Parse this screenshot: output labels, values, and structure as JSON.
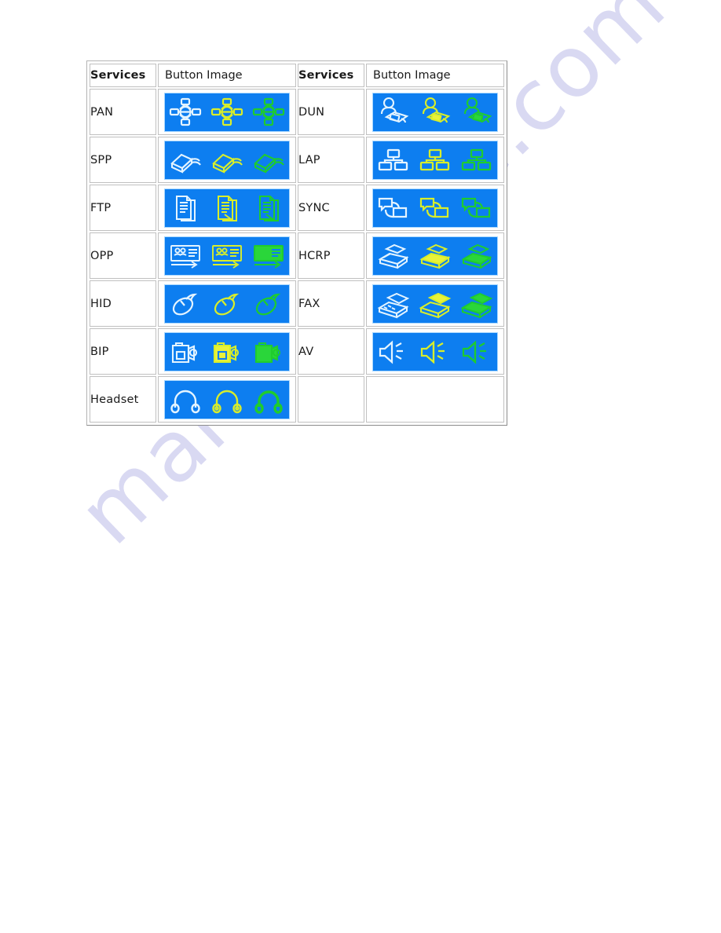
{
  "page": {
    "background_color": "#ffffff",
    "watermark_text": "manualshive.com",
    "watermark_color": "#d9d9f2"
  },
  "table": {
    "accent_blue": "#0d7ef0",
    "border_color": "#c0c0c0",
    "icon_variant_colors": [
      "#e4f4ff",
      "#d8ee2a",
      "#1fcc2e"
    ],
    "headers": {
      "services_left": "Services",
      "button_image_left": "Button Image",
      "services_right": "Services",
      "button_image_right": "Button Image"
    },
    "rows": [
      {
        "left_service": "PAN",
        "left_icon": "pan-network-icon",
        "right_service": "DUN",
        "right_icon": "dun-dialup-networking-icon"
      },
      {
        "left_service": "SPP",
        "left_icon": "spp-serial-port-icon",
        "right_service": "LAP",
        "right_icon": "lap-lan-access-icon"
      },
      {
        "left_service": "FTP",
        "left_icon": "ftp-file-transfer-icon",
        "right_service": "SYNC",
        "right_icon": "sync-synchronization-icon"
      },
      {
        "left_service": "OPP",
        "left_icon": "opp-object-push-icon",
        "right_service": "HCRP",
        "right_icon": "hcrp-printer-icon"
      },
      {
        "left_service": "HID",
        "left_icon": "hid-mouse-icon",
        "right_service": "FAX",
        "right_icon": "fax-machine-icon"
      },
      {
        "left_service": "BIP",
        "left_icon": "bip-camera-imaging-icon",
        "right_service": "AV",
        "right_icon": "av-speaker-icon"
      },
      {
        "left_service": "Headset",
        "left_icon": "headset-icon",
        "right_service": "",
        "right_icon": ""
      }
    ]
  }
}
